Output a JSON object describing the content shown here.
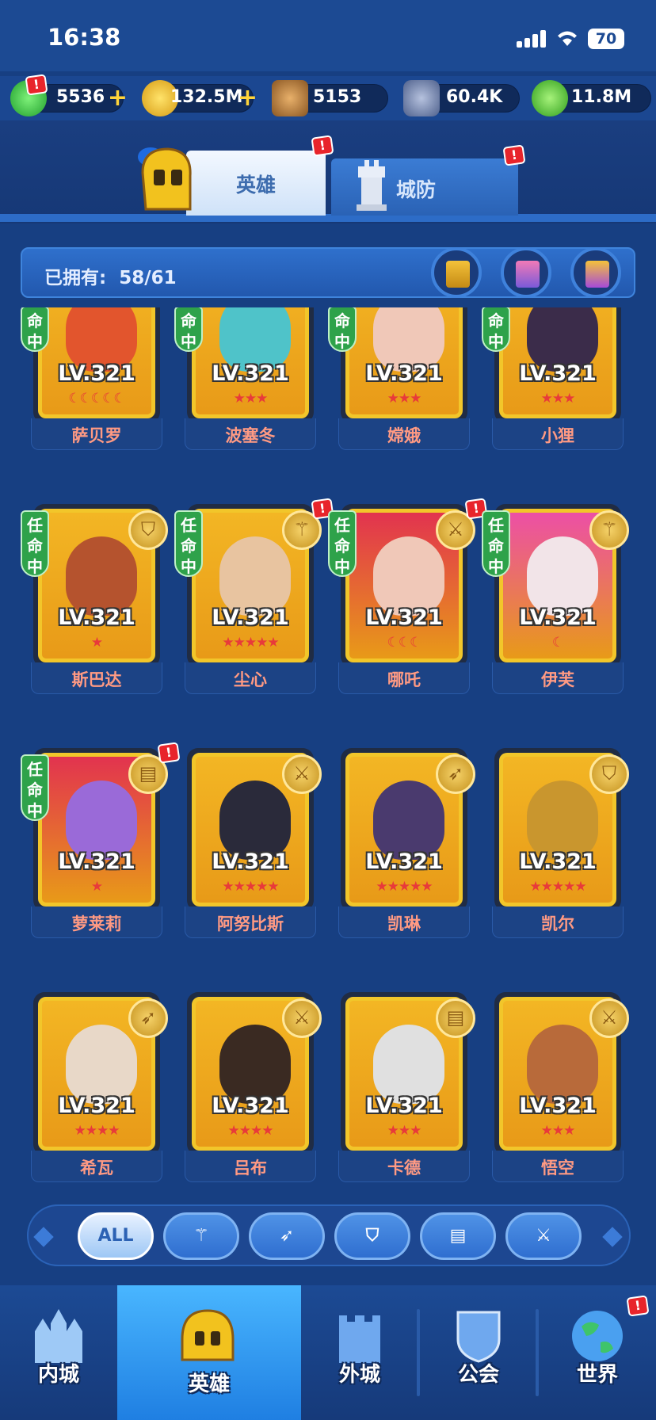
{
  "status": {
    "time": "16:38",
    "battery": "70"
  },
  "resources": [
    {
      "name": "gem",
      "value": "5536",
      "has_plus": true,
      "color": "#2fbf3a"
    },
    {
      "name": "gold",
      "value": "132.5M",
      "has_plus": true,
      "color": "#f2b51a"
    },
    {
      "name": "hammer",
      "value": "5153",
      "has_plus": false,
      "color": "#b8782a"
    },
    {
      "name": "ore",
      "value": "60.4K",
      "has_plus": false,
      "color": "#6a7ea8"
    },
    {
      "name": "crystal",
      "value": "11.8M",
      "has_plus": false,
      "color": "#4fcc2e"
    }
  ],
  "tabs": {
    "hero": "英雄",
    "defense": "城防"
  },
  "owned": {
    "label": "已拥有:",
    "count": "58/61"
  },
  "heroes": [
    {
      "name": "萨贝罗",
      "level": "LV.321",
      "stars": "☾☾☾☾☾",
      "tag": "命中",
      "class_icon": "",
      "bg": "#f3b624",
      "skin": "#e2552d"
    },
    {
      "name": "波塞冬",
      "level": "LV.321",
      "stars": "★★★",
      "tag": "命中",
      "class_icon": "",
      "bg": "#f3b624",
      "skin": "#4fc3c9"
    },
    {
      "name": "嫦娥",
      "level": "LV.321",
      "stars": "★★★",
      "tag": "命中",
      "class_icon": "",
      "bg": "#f3b624",
      "skin": "#f0c8b8"
    },
    {
      "name": "小狸",
      "level": "LV.321",
      "stars": "★★★",
      "tag": "命中",
      "class_icon": "",
      "bg": "#f3b624",
      "skin": "#3b2c4a"
    },
    {
      "name": "斯巴达",
      "level": "LV.321",
      "stars": "★",
      "tag": "任命中",
      "class_icon": "shield",
      "bg": "#f3b624",
      "skin": "#b5532e"
    },
    {
      "name": "尘心",
      "level": "LV.321",
      "stars": "★★★★★",
      "tag": "任命中",
      "class_icon": "staff",
      "bg": "#f3b624",
      "skin": "#e8c4a0"
    },
    {
      "name": "哪吒",
      "level": "LV.321",
      "stars": "☾☾☾",
      "tag": "任命中",
      "class_icon": "sword",
      "bg": "#e2334f",
      "skin": "#f0c8b8"
    },
    {
      "name": "伊芙",
      "level": "LV.321",
      "stars": "☾",
      "tag": "任命中",
      "class_icon": "staff",
      "bg": "#ec4fa6",
      "skin": "#f2e4e8"
    },
    {
      "name": "萝莱莉",
      "level": "LV.321",
      "stars": "★",
      "tag": "任命中",
      "class_icon": "book",
      "bg": "#e2334f",
      "skin": "#9a6ad8"
    },
    {
      "name": "阿努比斯",
      "level": "LV.321",
      "stars": "★★★★★",
      "tag": "",
      "class_icon": "sword",
      "bg": "#f3b624",
      "skin": "#2a2a3a"
    },
    {
      "name": "凯琳",
      "level": "LV.321",
      "stars": "★★★★★",
      "tag": "",
      "class_icon": "bow",
      "bg": "#f3b624",
      "skin": "#4a3a6e"
    },
    {
      "name": "凯尔",
      "level": "LV.321",
      "stars": "★★★★★",
      "tag": "",
      "class_icon": "shield",
      "bg": "#f3b624",
      "skin": "#c9962e"
    },
    {
      "name": "希瓦",
      "level": "LV.321",
      "stars": "★★★★",
      "tag": "",
      "class_icon": "bow",
      "bg": "#f3b624",
      "skin": "#e8d8c8"
    },
    {
      "name": "吕布",
      "level": "LV.321",
      "stars": "★★★★",
      "tag": "",
      "class_icon": "sword",
      "bg": "#f3b624",
      "skin": "#3a2a22"
    },
    {
      "name": "卡德",
      "level": "LV.321",
      "stars": "★★★",
      "tag": "",
      "class_icon": "book",
      "bg": "#f3b624",
      "skin": "#e0e0e0"
    },
    {
      "name": "悟空",
      "level": "LV.321",
      "stars": "★★★",
      "tag": "",
      "class_icon": "sword",
      "bg": "#f3b624",
      "skin": "#b86a3a"
    }
  ],
  "filters": {
    "all": "ALL",
    "icons": [
      "staff-icon",
      "bow-icon",
      "shield-icon",
      "book-icon",
      "sword-icon"
    ]
  },
  "nav": [
    {
      "label": "内城",
      "active": false
    },
    {
      "label": "英雄",
      "active": true
    },
    {
      "label": "外城",
      "active": false
    },
    {
      "label": "公会",
      "active": false
    },
    {
      "label": "世界",
      "active": false
    }
  ],
  "badges": {
    "exclaim": "!"
  }
}
